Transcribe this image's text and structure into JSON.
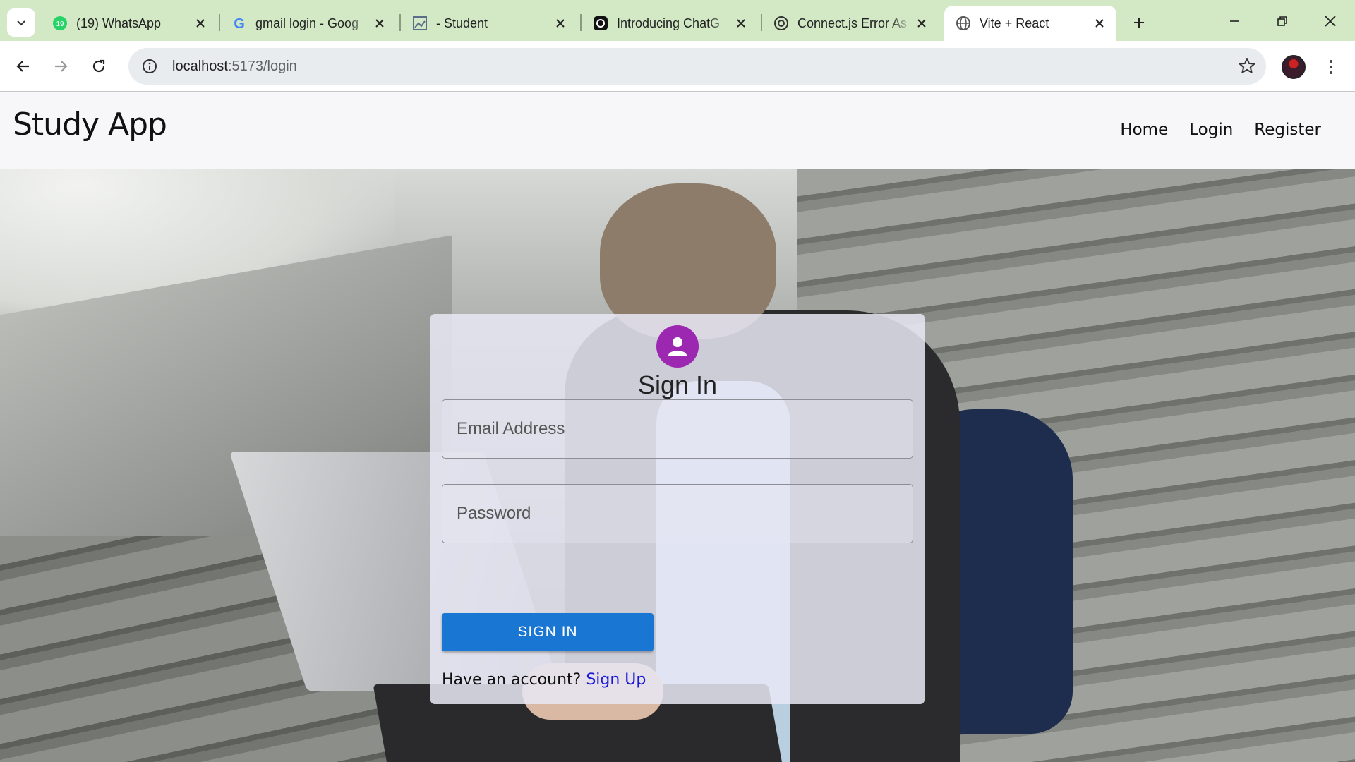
{
  "browser": {
    "tabs": [
      {
        "title": "(19) WhatsApp",
        "icon": "whatsapp-icon",
        "badge": "19"
      },
      {
        "title": "gmail login - Goog",
        "icon": "google-icon"
      },
      {
        "title": "- Student",
        "icon": "image-icon"
      },
      {
        "title": "Introducing ChatG",
        "icon": "openai-icon"
      },
      {
        "title": "Connect.js Error As",
        "icon": "openai-icon"
      },
      {
        "title": "Vite + React",
        "icon": "globe-icon",
        "active": true
      }
    ],
    "url_host": "localhost",
    "url_path": ":5173/login"
  },
  "app": {
    "brand": "Study App",
    "nav": [
      "Home",
      "Login",
      "Register"
    ]
  },
  "signin": {
    "title": "Sign In",
    "email_placeholder": "Email Address",
    "password_placeholder": "Password",
    "button": "SIGN IN",
    "footer_text": "Have an account?",
    "footer_link": "Sign Up"
  },
  "colors": {
    "tabbar": "#d3e9c6",
    "avatar_accent": "#9c27b0",
    "primary_button": "#1976d2",
    "link": "#1a1ad6"
  }
}
